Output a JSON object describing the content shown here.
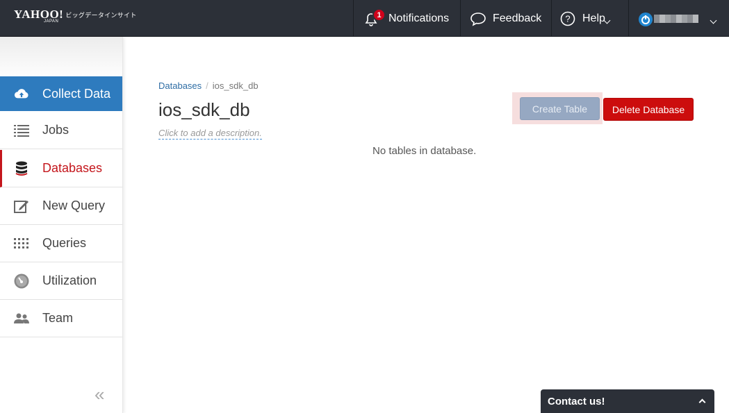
{
  "header": {
    "brand_yahoo": "YAHOO!",
    "brand_japan": "JAPAN",
    "brand_sub": "ビッグデータインサイト",
    "notifications_label": "Notifications",
    "notifications_count": "1",
    "feedback_label": "Feedback",
    "help_label": "Help"
  },
  "sidebar": {
    "items": [
      {
        "label": "Collect Data",
        "icon": "cloud-upload-icon"
      },
      {
        "label": "Jobs",
        "icon": "list-icon"
      },
      {
        "label": "Databases",
        "icon": "database-icon"
      },
      {
        "label": "New Query",
        "icon": "edit-icon"
      },
      {
        "label": "Queries",
        "icon": "grid-icon"
      },
      {
        "label": "Utilization",
        "icon": "gauge-icon"
      },
      {
        "label": "Team",
        "icon": "team-icon"
      }
    ],
    "collapse_label": "«"
  },
  "main": {
    "breadcrumb": {
      "parent": "Databases",
      "separator": "/",
      "current": "ios_sdk_db"
    },
    "title": "ios_sdk_db",
    "description_placeholder": "Click to add a description.",
    "create_table_label": "Create Table",
    "delete_database_label": "Delete Database",
    "empty_message": "No tables in database."
  },
  "contact": {
    "label": "Contact us!"
  },
  "colors": {
    "topbar": "#2c3038",
    "accent": "#2e7bbe",
    "danger": "#cc0d0d",
    "active": "#c4161c"
  }
}
